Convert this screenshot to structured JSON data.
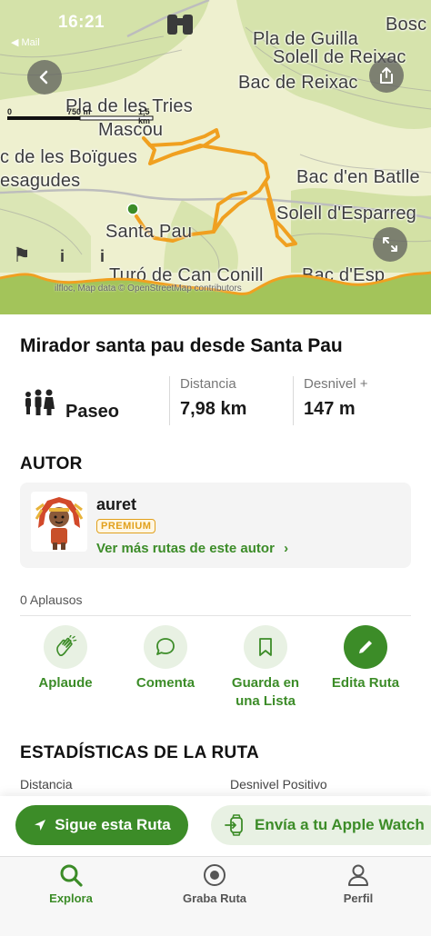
{
  "status": {
    "time": "16:21",
    "back_app": "◀ Mail"
  },
  "map": {
    "places": [
      "Bosc",
      "Pla de Guilla",
      "Solell de Reixac",
      "Bac de Reixac",
      "Pla de les Tries",
      "Mascou",
      "c de les Boïgues",
      "esagudes",
      "Bac d'en Batlle",
      "Solell d'Esparreg",
      "Santa Pau",
      "Turó de Can Conill",
      "Bac d'Esp"
    ],
    "scale": {
      "left": "0",
      "mid": "750 m",
      "right": "1,5 km"
    },
    "attribution": "ilfloc, Map data © OpenStreetMap contributors",
    "icons": [
      "back-icon",
      "share-icon",
      "expand-icon",
      "binoculars-icon"
    ],
    "colors": {
      "route": "#f0a020",
      "terrain": "#eef0cf",
      "forest": "#d4e2a9"
    }
  },
  "route": {
    "title": "Mirador santa pau desde Santa Pau",
    "type": "Paseo",
    "distance_label": "Distancia",
    "distance_value": "7,98 km",
    "elevation_label": "Desnivel +",
    "elevation_value": "147 m"
  },
  "author": {
    "section_title": "AUTOR",
    "name": "auret",
    "badge": "PREMIUM",
    "more_link": "Ver más rutas de este autor",
    "more_link_icon": "chevron-right-icon"
  },
  "applause": {
    "count_text": "0 Aplausos"
  },
  "actions": [
    {
      "label": "Aplaude",
      "icon": "clap-icon"
    },
    {
      "label": "Comenta",
      "icon": "comment-icon"
    },
    {
      "label": "Guarda en una Lista",
      "icon": "bookmark-icon"
    },
    {
      "label": "Edita Ruta",
      "icon": "pencil-icon"
    }
  ],
  "stats_section": {
    "title": "ESTADÍSTICAS DE LA RUTA",
    "col1": "Distancia",
    "col2": "Desnivel Positivo"
  },
  "cta": {
    "primary": "Sigue esta Ruta",
    "secondary": "Envía a tu Apple Watch"
  },
  "tabs": [
    {
      "label": "Explora",
      "icon": "search-icon",
      "active": true
    },
    {
      "label": "Graba Ruta",
      "icon": "record-icon",
      "active": false
    },
    {
      "label": "Perfil",
      "icon": "person-icon",
      "active": false
    }
  ],
  "colors": {
    "accent": "#3c8c28",
    "accent_light": "#e8f1e3",
    "premium": "#e1a01c"
  }
}
